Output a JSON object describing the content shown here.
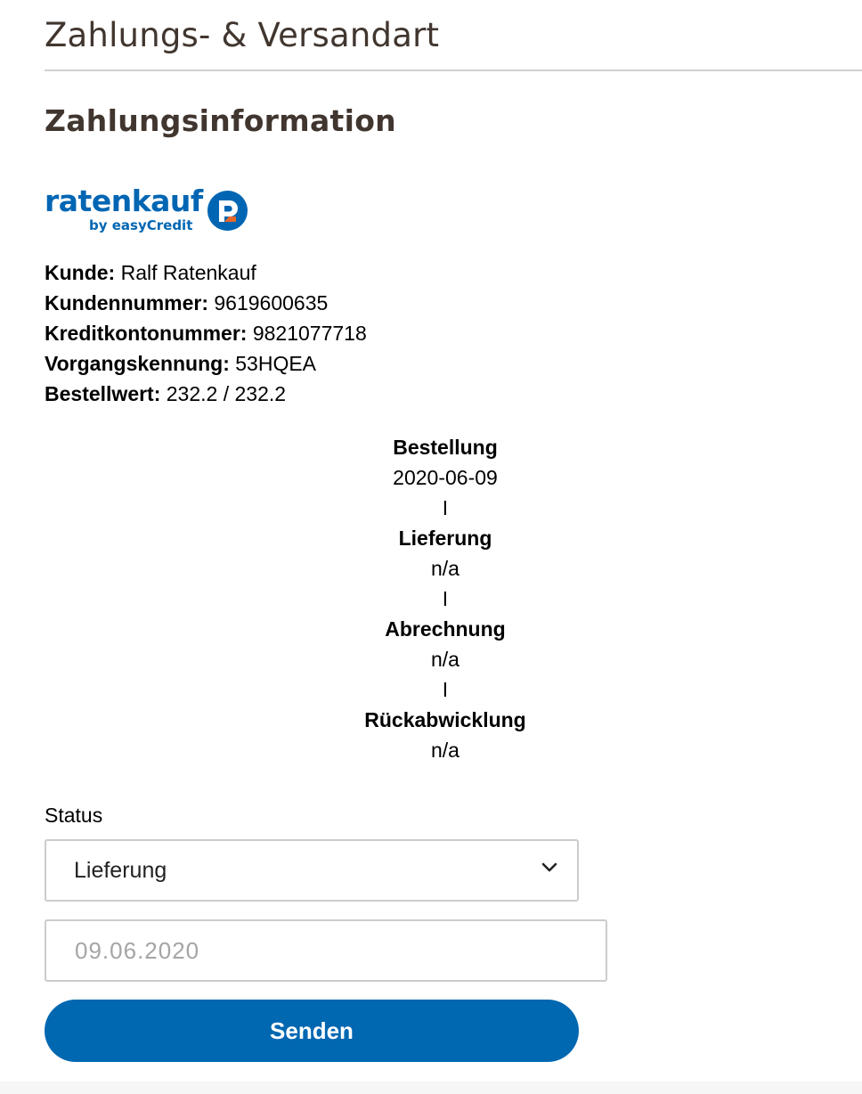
{
  "section_title": "Zahlungs- & Versandart",
  "sub_title": "Zahlungsinformation",
  "logo": {
    "word": "ratenkauf",
    "byline": "by easyCredit",
    "colors": {
      "brand_blue": "#0066b3",
      "accent_orange": "#e8672b"
    }
  },
  "info": [
    {
      "label": "Kunde:",
      "value": "Ralf Ratenkauf"
    },
    {
      "label": "Kundennummer:",
      "value": "9619600635"
    },
    {
      "label": "Kreditkontonummer:",
      "value": "9821077718"
    },
    {
      "label": "Vorgangskennung:",
      "value": "53HQEA"
    },
    {
      "label": "Bestellwert:",
      "value": "232.2 / 232.2"
    }
  ],
  "timeline": {
    "separator": "I",
    "steps": [
      {
        "label": "Bestellung",
        "value": "2020-06-09"
      },
      {
        "label": "Lieferung",
        "value": "n/a"
      },
      {
        "label": "Abrechnung",
        "value": "n/a"
      },
      {
        "label": "Rückabwicklung",
        "value": "n/a"
      }
    ]
  },
  "form": {
    "status_label": "Status",
    "status_selected": "Lieferung",
    "date_placeholder": "09.06.2020",
    "submit_label": "Senden",
    "button_color": "#0067b1"
  }
}
